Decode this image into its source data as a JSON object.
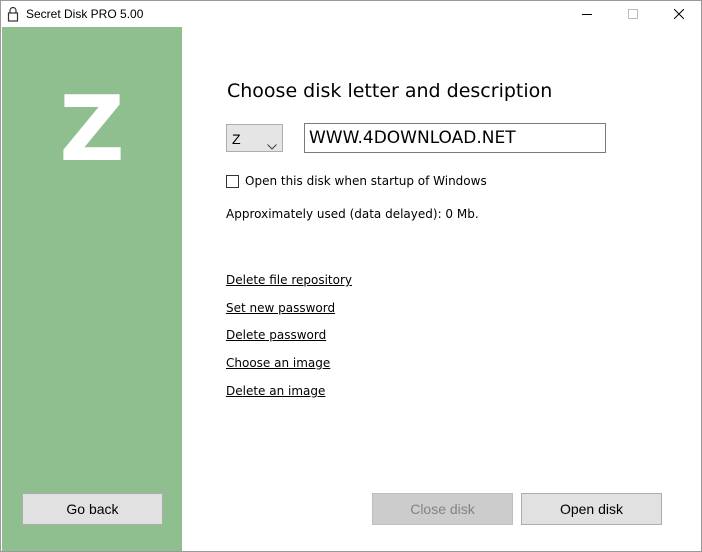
{
  "window": {
    "title": "Secret Disk PRO 5.00",
    "controls": {
      "minimize": "minimize-icon",
      "maximize": "maximize-icon",
      "close": "close-icon"
    }
  },
  "sidebar": {
    "drive_letter": "Z",
    "background_color": "#8fbf8f"
  },
  "main": {
    "heading": "Choose disk letter and description",
    "letter_select": {
      "value": "Z"
    },
    "description_input": {
      "value": "WWW.4DOWNLOAD.NET"
    },
    "startup_checkbox": {
      "label": "Open this disk when startup of Windows",
      "checked": false
    },
    "usage_text": "Approximately used (data delayed): 0 Mb.",
    "links": [
      "Delete file repository",
      "Set new password",
      "Delete password",
      "Choose an image",
      "Delete an image"
    ]
  },
  "buttons": {
    "go_back": "Go back",
    "close_disk": {
      "label": "Close disk",
      "disabled": true
    },
    "open_disk": "Open disk"
  }
}
